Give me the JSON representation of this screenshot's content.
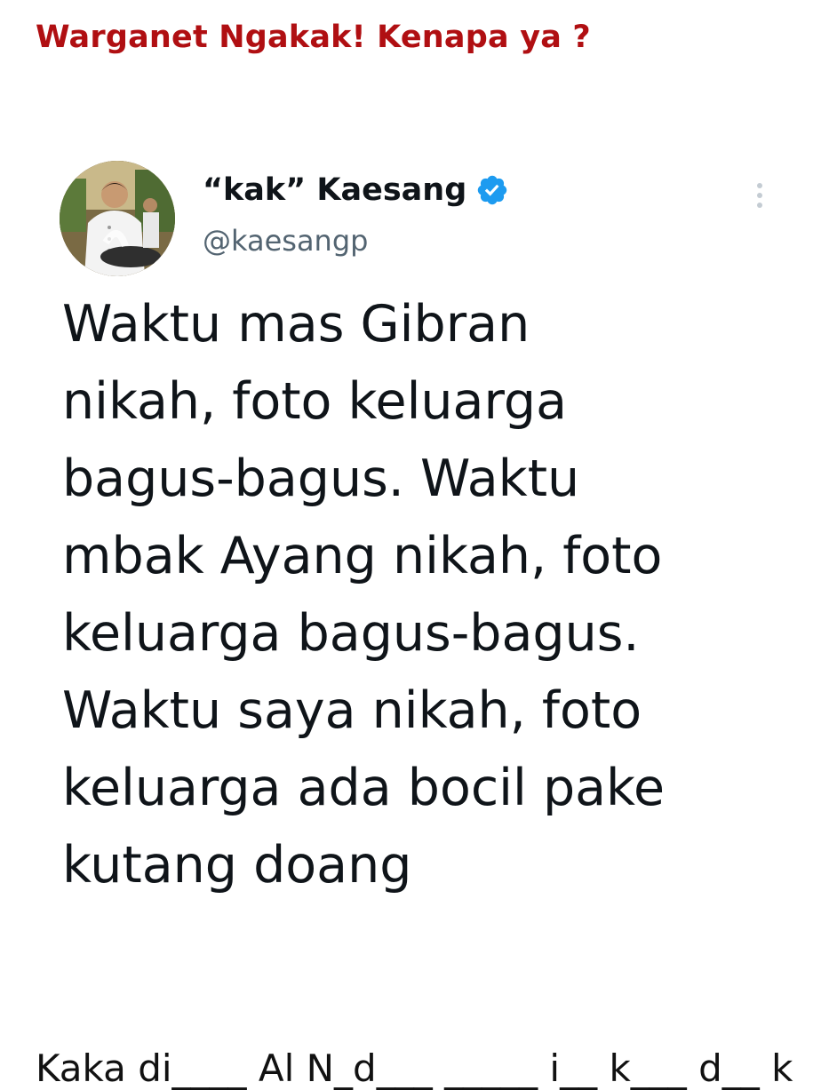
{
  "headline": "Warganet Ngakak! Kenapa ya ?",
  "tweet": {
    "display_name": "“kak” Kaesang",
    "handle": "@kaesangp",
    "verified_icon": "verified-badge-icon",
    "more_icon": "more-options-icon",
    "avatar_icon": "profile-photo",
    "lines": [
      "Waktu mas Gibran",
      "nikah, foto keluarga",
      "bagus-bagus. Waktu",
      "mbak Ayang nikah, foto",
      "keluarga bagus-bagus.",
      "Waktu saya nikah, foto",
      "keluarga ada bocil pake",
      "kutang doang"
    ]
  },
  "footer_caption": "Kaka di____ Al N_d___ _____ i__ k___ d__ k",
  "colors": {
    "headline": "#b00f12",
    "verified": "#1d9bf0",
    "text": "#0f1419",
    "handle": "#536471"
  }
}
